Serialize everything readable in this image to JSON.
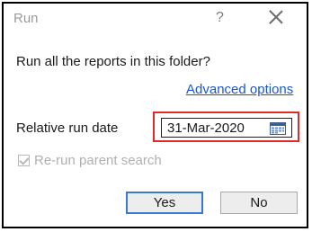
{
  "dialog": {
    "title": "Run",
    "help_glyph": "?",
    "question": "Run all the reports in this folder?",
    "advanced_link": "Advanced options",
    "relative_run_date_label": "Relative run date",
    "date_value": "31-Mar-2020",
    "rerun_parent_search": {
      "label": "Re-run parent search",
      "checked": true,
      "disabled": true
    },
    "buttons": {
      "yes": "Yes",
      "no": "No"
    }
  },
  "colors": {
    "highlight_border": "#e12a2a",
    "link": "#1a56d1",
    "default_button_border": "#3a78d6"
  },
  "icons": {
    "close": "close-icon",
    "calendar": "calendar-icon"
  }
}
